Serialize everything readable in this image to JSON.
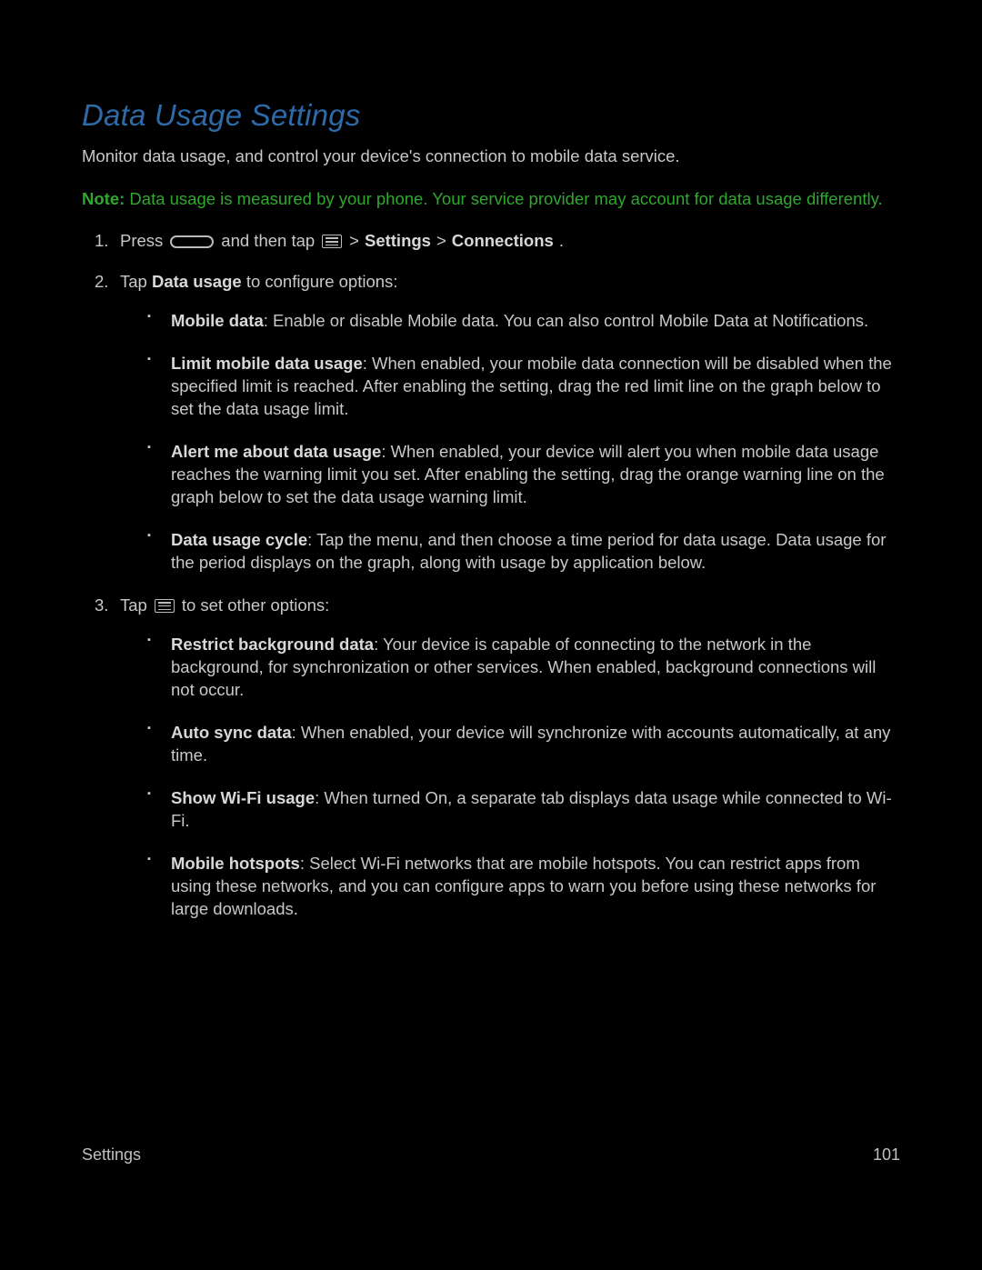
{
  "title": "Data Usage Settings",
  "intro": "Monitor data usage, and control your device's connection to mobile data service.",
  "note": {
    "label": "Note:",
    "text": " Data usage is measured by your phone. Your service provider may account for data usage differently."
  },
  "step1": {
    "press": "Press ",
    "andthen": " and then tap ",
    "gt1": " > ",
    "settings": "Settings",
    "gt2": " > ",
    "connections": "Connections",
    "dot": "."
  },
  "step2": {
    "pre": "Tap ",
    "bold": "Data usage",
    "post": " to configure options:",
    "items": [
      {
        "bold": "Mobile data",
        "rest": ": Enable or disable Mobile data. You can also control Mobile Data at Notifications."
      },
      {
        "bold": "Limit mobile data usage",
        "rest": ": When enabled, your mobile data connection will be disabled when the specified limit is reached. After enabling the setting, drag the red limit line on the graph below to set the data usage limit."
      },
      {
        "bold": "Alert me about data usage",
        "rest": ": When enabled, your device will alert you when mobile data usage reaches the warning limit you set. After enabling the setting, drag the orange warning line on the graph below to set the data usage warning limit."
      },
      {
        "bold": "Data usage cycle",
        "rest": ": Tap the menu, and then choose a time period for data usage. Data usage for the period displays on the graph, along with usage by application below."
      }
    ]
  },
  "step3": {
    "pre": "Tap ",
    "post": " to set other options:",
    "items": [
      {
        "bold": "Restrict background data",
        "rest": ": Your device is capable of connecting to the network in the background, for synchronization or other services. When enabled, background connections will not occur."
      },
      {
        "bold": "Auto sync data",
        "rest": ": When enabled, your device will synchronize with accounts automatically, at any time."
      },
      {
        "bold": "Show Wi-Fi usage",
        "rest": ": When turned On, a separate tab displays data usage while connected to Wi-Fi."
      },
      {
        "bold": "Mobile hotspots",
        "rest": ": Select Wi-Fi networks that are mobile hotspots. You can restrict apps from using these networks, and you can configure apps to warn you before using these networks for large downloads."
      }
    ]
  },
  "footer": {
    "left": "Settings",
    "right": "101"
  }
}
